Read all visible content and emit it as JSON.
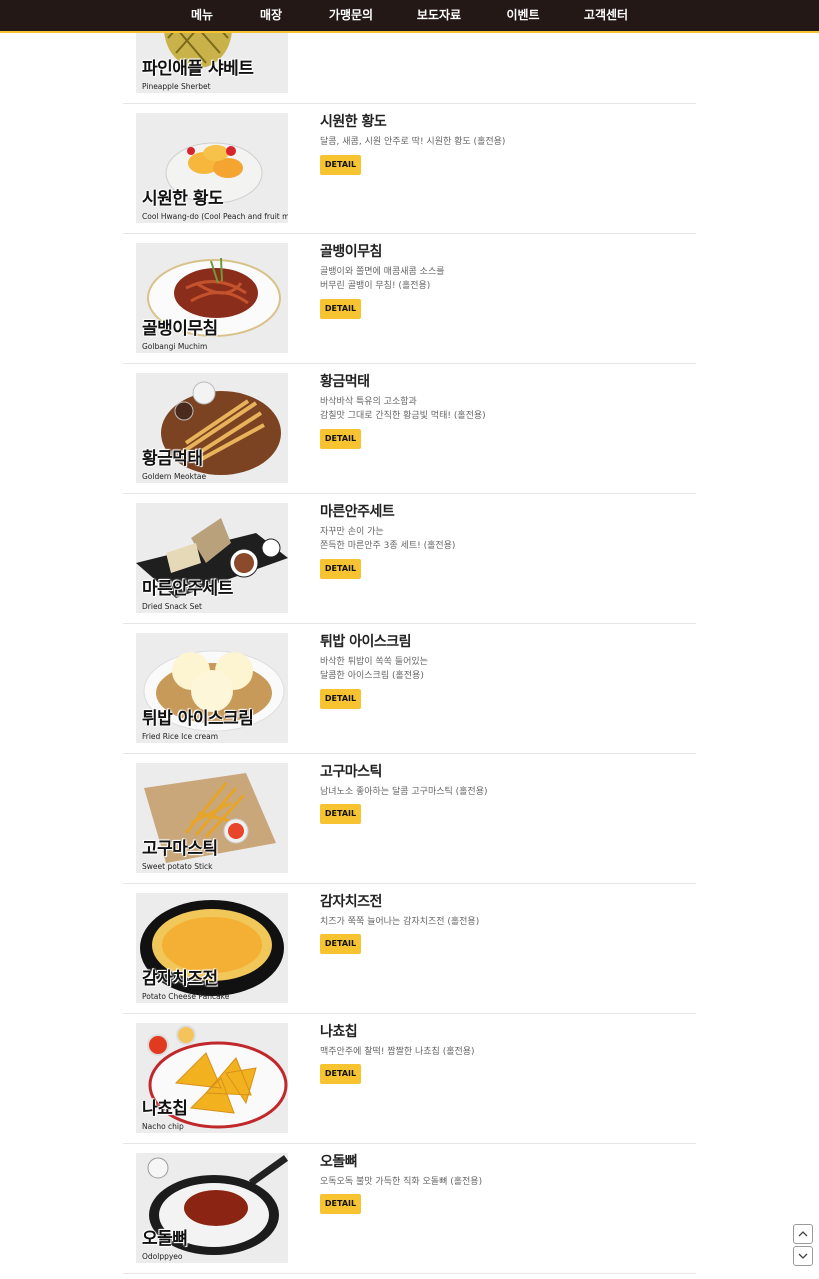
{
  "nav": {
    "items": [
      {
        "label": "메뉴"
      },
      {
        "label": "매장"
      },
      {
        "label": "가맹문의"
      },
      {
        "label": "보도자료"
      },
      {
        "label": "이벤트"
      },
      {
        "label": "고객센터"
      }
    ]
  },
  "colors": {
    "nav_bg": "#231815",
    "accent_yellow": "#f7c331",
    "divider": "#e6e6e6"
  },
  "menu": {
    "detail_label": "DETAIL",
    "items": [
      {
        "id": "pineapple",
        "title": "",
        "thumb_ko": "파인애플 샤베트",
        "thumb_en": "Pineapple Sherbet",
        "desc": [],
        "icon": "pineapple-sherbet-photo"
      },
      {
        "id": "hwangdo",
        "title": "시원한 황도",
        "thumb_ko": "시원한 황도",
        "thumb_en": "Cool Hwang-do (Cool Peach and fruit mix)",
        "desc": [
          "달콤, 새콤, 시원 안주로 딱! 시원한 황도 (홀전용)"
        ],
        "icon": "peach-bowl-photo"
      },
      {
        "id": "golbangi",
        "title": "골뱅이무침",
        "thumb_ko": "골뱅이무침",
        "thumb_en": "Golbangi Muchim",
        "desc": [
          "골뱅이와 쫄면에 매콤새콤 소스를",
          "버무린 골뱅이 무침! (홀전용)"
        ],
        "icon": "noodle-plate-photo"
      },
      {
        "id": "meoktae",
        "title": "황금먹태",
        "thumb_ko": "황금먹태",
        "thumb_en": "Goldern Meoktae",
        "desc": [
          "바삭바삭 특유의 고소함과",
          "감칠맛 그대로 간직한 황금빛 먹태! (홀전용)"
        ],
        "icon": "dried-fish-photo"
      },
      {
        "id": "snackset",
        "title": "마른안주세트",
        "thumb_ko": "마른안주세트",
        "thumb_en": "Dried Snack Set",
        "desc": [
          "자꾸만 손이 가는",
          "쫀득한 마른안주 3종 세트! (홀전용)"
        ],
        "icon": "snack-set-photo"
      },
      {
        "id": "icecream",
        "title": "튀밥 아이스크림",
        "thumb_ko": "튀밥 아이스크림",
        "thumb_en": "Fried Rice Ice cream",
        "desc": [
          "바삭한 튀밥이 쏙쏙 들어있는",
          "달콤한 아이스크림 (홀전용)"
        ],
        "icon": "ice-cream-photo"
      },
      {
        "id": "sweetpotato",
        "title": "고구마스틱",
        "thumb_ko": "고구마스틱",
        "thumb_en": "Sweet potato Stick",
        "desc": [
          "남녀노소 좋아하는 달콤 고구마스틱 (홀전용)"
        ],
        "icon": "sweet-potato-stick-photo"
      },
      {
        "id": "potatocheese",
        "title": "감자치즈전",
        "thumb_ko": "감자치즈전",
        "thumb_en": "Potato Cheese Pancake",
        "desc": [
          "치즈가 쭉쭉 늘어나는 감자치즈전 (홀전용)"
        ],
        "icon": "cheese-pancake-photo"
      },
      {
        "id": "nacho",
        "title": "나쵸칩",
        "thumb_ko": "나쵸칩",
        "thumb_en": "Nacho chip",
        "desc": [
          "맥주안주에 찰떡! 짭짤한 나쵸칩 (홀전용)"
        ],
        "icon": "nacho-chip-photo"
      },
      {
        "id": "odolppyeo",
        "title": "오돌뼈",
        "thumb_ko": "오돌뼈",
        "thumb_en": "Odolppyeo",
        "desc": [
          "오독오독 불맛 가득한 직화 오돌뼈 (홀전용)"
        ],
        "icon": "odolppyeo-pan-photo"
      }
    ]
  },
  "scroll": {
    "up_icon": "chevron-up-icon",
    "down_icon": "chevron-down-icon"
  }
}
